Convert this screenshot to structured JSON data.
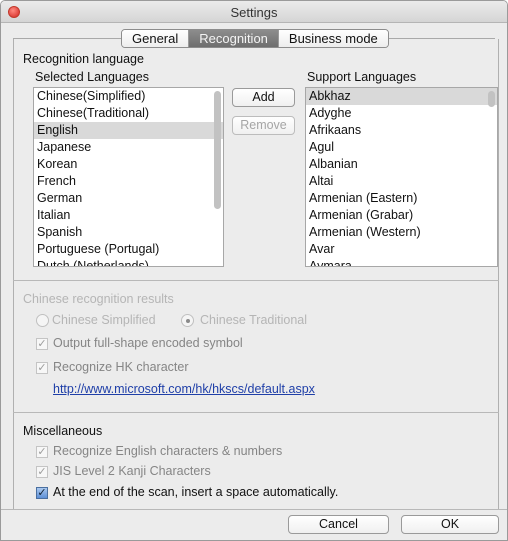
{
  "window": {
    "title": "Settings"
  },
  "tabs": [
    {
      "label": "General",
      "active": false
    },
    {
      "label": "Recognition",
      "active": true
    },
    {
      "label": "Business mode",
      "active": false
    }
  ],
  "recognition_language": {
    "heading": "Recognition language",
    "selected_heading": "Selected Languages",
    "support_heading": "Support Languages",
    "selected_languages": [
      "Chinese(Simplified)",
      "Chinese(Traditional)",
      "English",
      "Japanese",
      "Korean",
      "French",
      "German",
      "Italian",
      "Spanish",
      "Portuguese (Portugal)",
      "Dutch (Netherlands)"
    ],
    "selected_index": 2,
    "support_languages": [
      "Abkhaz",
      "Adyghe",
      "Afrikaans",
      "Agul",
      "Albanian",
      "Altai",
      "Armenian (Eastern)",
      "Armenian (Grabar)",
      "Armenian (Western)",
      "Avar",
      "Aymara"
    ],
    "support_selected_index": 0,
    "add_label": "Add",
    "remove_label": "Remove"
  },
  "chinese_results": {
    "heading": "Chinese recognition results",
    "option_simplified": "Chinese Simplified",
    "option_traditional": "Chinese Traditional",
    "selected": "traditional",
    "fullshape_label": "Output full-shape encoded symbol",
    "hk_label": "Recognize HK character",
    "hk_link": "http://www.microsoft.com/hk/hkscs/default.aspx"
  },
  "misc": {
    "heading": "Miscellaneous",
    "english_numbers_label": "Recognize English characters & numbers",
    "jis_label": "JIS Level 2 Kanji Characters",
    "insert_space_label": "At the end of the scan, insert a space automatically.",
    "insert_space_checked": true
  },
  "footer": {
    "cancel_label": "Cancel",
    "ok_label": "OK"
  }
}
